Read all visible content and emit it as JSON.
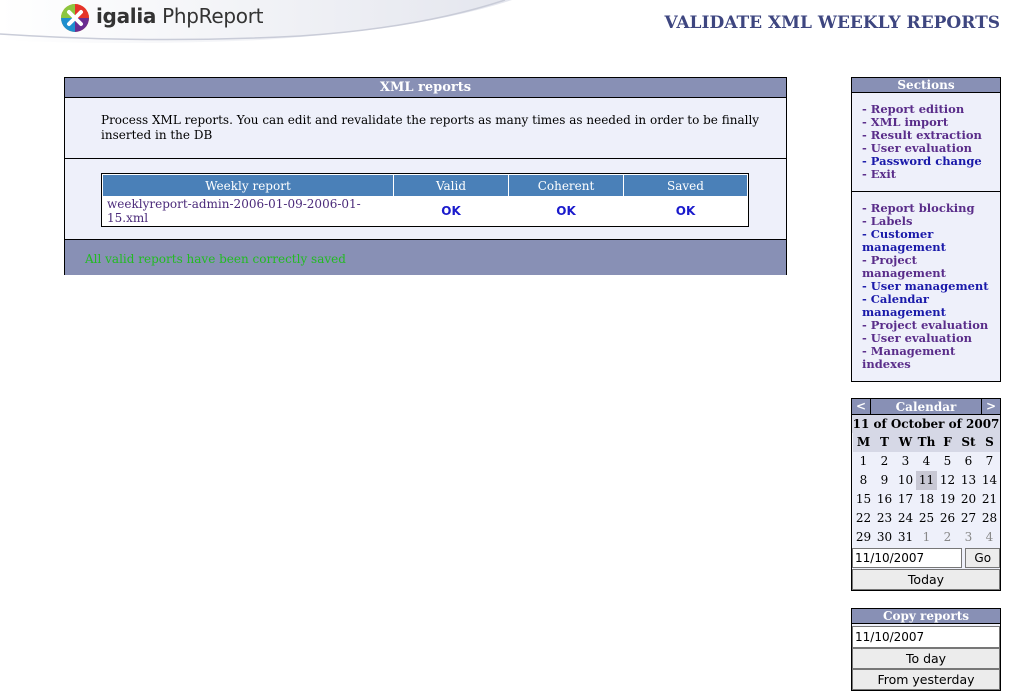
{
  "header": {
    "logo_brand": "igalia",
    "logo_product": "PhpReport",
    "page_title": "VALIDATE XML WEEKLY REPORTS"
  },
  "main": {
    "title": "XML reports",
    "description": "Process XML reports. You can edit and revalidate the reports as many times as needed in order to be finally inserted in the DB",
    "table": {
      "headers": [
        "Weekly report",
        "Valid",
        "Coherent",
        "Saved"
      ],
      "rows": [
        {
          "file": "weeklyreport-admin-2006-01-09-2006-01-15.xml",
          "valid": "OK",
          "coherent": "OK",
          "saved": "OK"
        }
      ]
    },
    "status": "All valid reports have been correctly saved"
  },
  "sections": {
    "title": "Sections",
    "group1": [
      "- Report edition",
      "- XML import",
      "- Result extraction",
      "- User evaluation",
      "- Password change",
      "- Exit"
    ],
    "group2": [
      "- Report blocking",
      "- Labels",
      "- Customer management",
      "- Project management",
      "- User management",
      "- Calendar management",
      "- Project evaluation",
      "- User evaluation",
      "- Management indexes"
    ]
  },
  "calendar": {
    "prev": "<",
    "next": ">",
    "title": "Calendar",
    "current_date": "11 of October of 2007",
    "day_headers": [
      "M",
      "T",
      "W",
      "Th",
      "F",
      "St",
      "S"
    ],
    "weeks": [
      [
        "1",
        "2",
        "3",
        "4",
        "5",
        "6",
        "7"
      ],
      [
        "8",
        "9",
        "10",
        "11",
        "12",
        "13",
        "14"
      ],
      [
        "15",
        "16",
        "17",
        "18",
        "19",
        "20",
        "21"
      ],
      [
        "22",
        "23",
        "24",
        "25",
        "26",
        "27",
        "28"
      ],
      [
        "29",
        "30",
        "31",
        "1",
        "2",
        "3",
        "4"
      ]
    ],
    "input_value": "11/10/2007",
    "go_label": "Go",
    "today_label": "Today"
  },
  "copy_reports": {
    "title": "Copy reports",
    "input_value": "11/10/2007",
    "to_day_label": "To day",
    "from_yesterday_label": "From yesterday"
  },
  "colors": {
    "header_bar": "#8890b5",
    "table_header": "#4a80b8",
    "panel_bg": "#eef0fa",
    "title_text": "#3e4680",
    "status_text": "#22bb22",
    "ok_text": "#1a1acc"
  }
}
